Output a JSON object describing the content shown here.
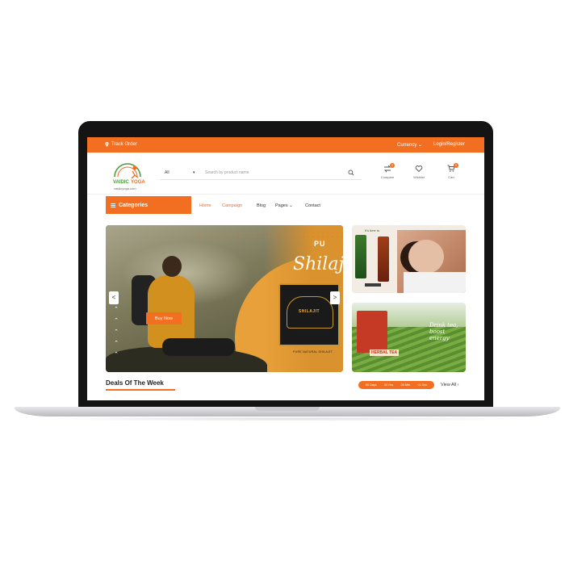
{
  "topbar": {
    "track_order": "Track Order",
    "currency": "Currency ⌄",
    "login_register": "Login/Register"
  },
  "logo": {
    "brand": "VAIDIC YOGA",
    "site": "vaidicyoga.com"
  },
  "search": {
    "category": "All",
    "placeholder": "Search by product name"
  },
  "header_icons": {
    "compare": {
      "label": "Compare",
      "count": "0",
      "icon": "compare-icon"
    },
    "wishlist": {
      "label": "Wishlist",
      "icon": "heart-icon"
    },
    "cart": {
      "label": "Cart",
      "count": "0",
      "icon": "cart-icon"
    }
  },
  "nav": {
    "categories_label": "Categories",
    "items": [
      {
        "label": "Home",
        "active": true
      },
      {
        "label": "Campaign",
        "active": true
      },
      {
        "label": "Blog",
        "active": false
      },
      {
        "label": "Pages ⌄",
        "active": false
      },
      {
        "label": "Contact",
        "active": false
      }
    ]
  },
  "hero": {
    "title_prefix": "PU",
    "title": "Shilaj",
    "product_label": "SHILAJIT",
    "caption": "PURE NATURAL SHILAJIT",
    "buy_now": "Buy Now",
    "prev": "<",
    "next": ">"
  },
  "side_banners": {
    "first": {
      "tagline": "It's time to"
    },
    "second": {
      "product": "HERBAL TEA",
      "script": "Drink tea, boost energy"
    }
  },
  "deals": {
    "title": "Deals Of The Week",
    "countdown": [
      "00 Days",
      "00 Hrs",
      "00 Min",
      "00 Sec"
    ],
    "view_all": "View All  ›"
  },
  "colors": {
    "accent": "#f26e21",
    "laptop_frame": "#141414"
  }
}
